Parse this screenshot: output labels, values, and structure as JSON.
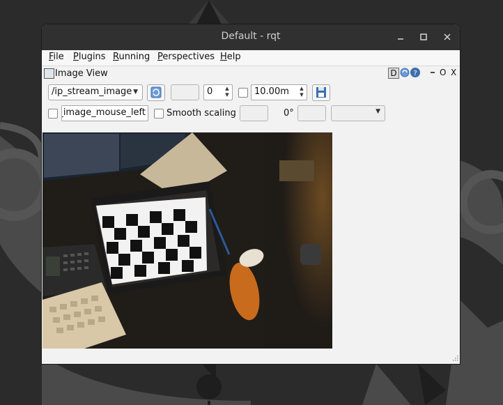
{
  "window": {
    "title": "Default - rqt",
    "controls": {
      "minimize_icon": "minimize-icon",
      "maximize_icon": "maximize-icon",
      "close_icon": "close-icon"
    }
  },
  "menubar": {
    "items": [
      {
        "label": "File",
        "mnemonic": "F",
        "rest": "ile"
      },
      {
        "label": "Plugins",
        "mnemonic": "P",
        "rest": "lugins"
      },
      {
        "label": "Running",
        "mnemonic": "R",
        "rest": "unning"
      },
      {
        "label": "Perspectives",
        "mnemonic": "P",
        "rest": "erspectives"
      },
      {
        "label": "Help",
        "mnemonic": "H",
        "rest": "elp"
      }
    ]
  },
  "plugin": {
    "title": "Image View",
    "dock_controls": {
      "d": "D",
      "o": "O",
      "x": "X"
    }
  },
  "toolbar1": {
    "topic": "/ip_stream_image",
    "spin_value": "0",
    "max_range": "10.00m"
  },
  "toolbar2": {
    "mouse_topic": "h_image_mouse_left",
    "smooth_label": "Smooth scaling",
    "rotation": "0°"
  },
  "colors": {
    "desktop": "#2b2b2b",
    "titlebar": "#303030",
    "content": "#f2f2f2",
    "accent": "#3d7cc9"
  }
}
